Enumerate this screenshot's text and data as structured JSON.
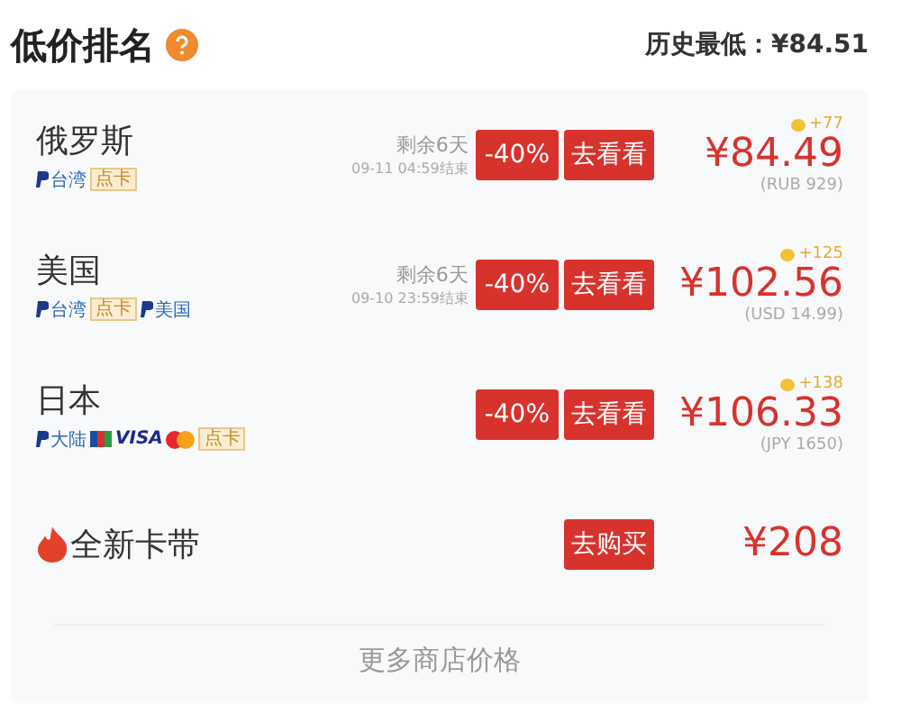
{
  "header": {
    "title": "低价排名",
    "history_low": "历史最低：¥84.51"
  },
  "stores": [
    {
      "kind": "region",
      "name": "俄罗斯",
      "payments": [
        {
          "kind": "paypal",
          "label": "台湾"
        },
        {
          "kind": "tag",
          "label": "点卡"
        }
      ],
      "countdown": "剩余6天",
      "end_time": "09-11 04:59结束",
      "discount": "-40%",
      "button": "去看看",
      "bonus": "+77",
      "price": "¥84.49",
      "original": "(RUB 929)"
    },
    {
      "kind": "region",
      "name": "美国",
      "payments": [
        {
          "kind": "paypal",
          "label": "台湾"
        },
        {
          "kind": "tag",
          "label": "点卡"
        },
        {
          "kind": "paypal",
          "label": "美国"
        }
      ],
      "countdown": "剩余6天",
      "end_time": "09-10 23:59结束",
      "discount": "-40%",
      "button": "去看看",
      "bonus": "+125",
      "price": "¥102.56",
      "original": "(USD 14.99)"
    },
    {
      "kind": "region",
      "name": "日本",
      "payments": [
        {
          "kind": "paypal",
          "label": "大陆"
        },
        {
          "kind": "jcb"
        },
        {
          "kind": "visa",
          "label": "VISA"
        },
        {
          "kind": "mastercard"
        },
        {
          "kind": "tag",
          "label": "点卡"
        }
      ],
      "discount": "-40%",
      "button": "去看看",
      "bonus": "+138",
      "price": "¥106.33",
      "original": "(JPY 1650)"
    },
    {
      "kind": "new",
      "name": "全新卡带",
      "button": "去购买",
      "price": "¥208"
    }
  ],
  "more": "更多商店价格"
}
